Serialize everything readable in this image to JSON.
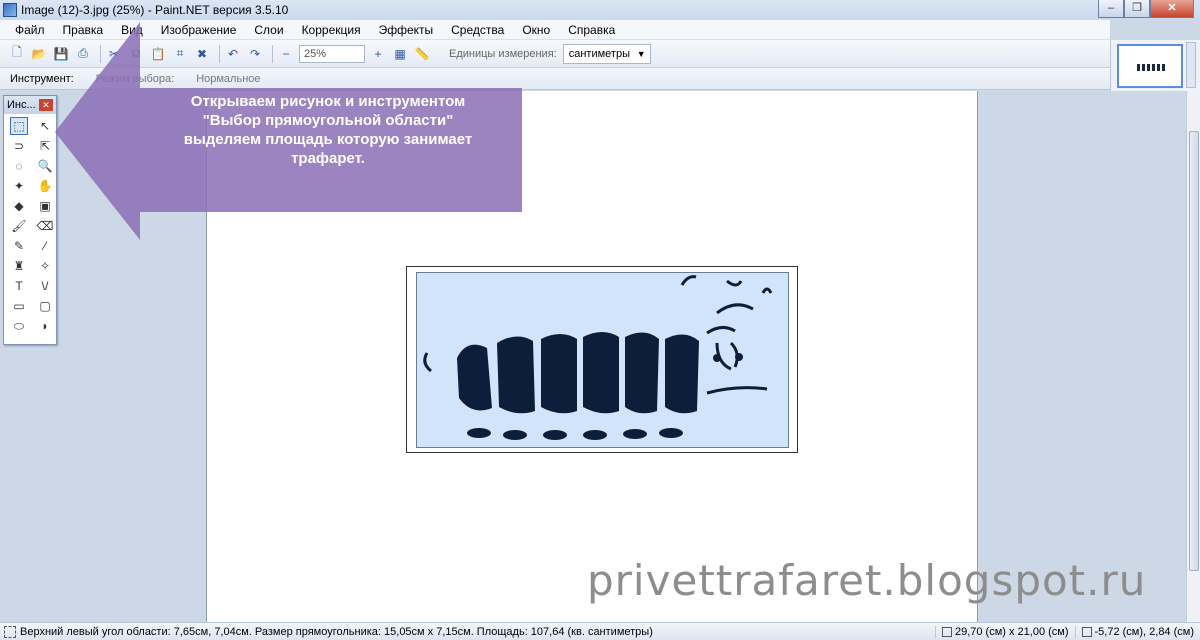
{
  "window": {
    "title": "Image (12)-3.jpg (25%) - Paint.NET версия 3.5.10",
    "minimize": "–",
    "restore": "❐",
    "close": "✕"
  },
  "menu": [
    "Файл",
    "Правка",
    "Вид",
    "Изображение",
    "Слои",
    "Коррекция",
    "Эффекты",
    "Средства",
    "Окно",
    "Справка"
  ],
  "toolbar": {
    "zoom_value": "25%",
    "units_label": "Единицы измерения:",
    "units_value": "сантиметры"
  },
  "toolbar2": {
    "tool_label": "Инструмент:",
    "selection_mode_label": "Режим выбора:",
    "blend_mode": "Нормальное"
  },
  "tools_window": {
    "title": "Инс..."
  },
  "callout": {
    "lines": [
      "Открываем рисунок и инструментом",
      "\"Выбор прямоугольной области\"",
      "выделяем площадь которую занимает",
      "трафарет."
    ],
    "color": "#8a6fb5"
  },
  "watermark": "privettrafaret.blogspot.ru",
  "status": {
    "selection_info": "Верхний левый угол области: 7,65см, 7,04см. Размер прямоугольника: 15,05см x 7,15см. Площадь: 107,64 (кв. сантиметры)",
    "image_size": "29,70 (см) x 21,00 (см)",
    "cursor": "-5,72 (см), 2,84 (см)"
  }
}
